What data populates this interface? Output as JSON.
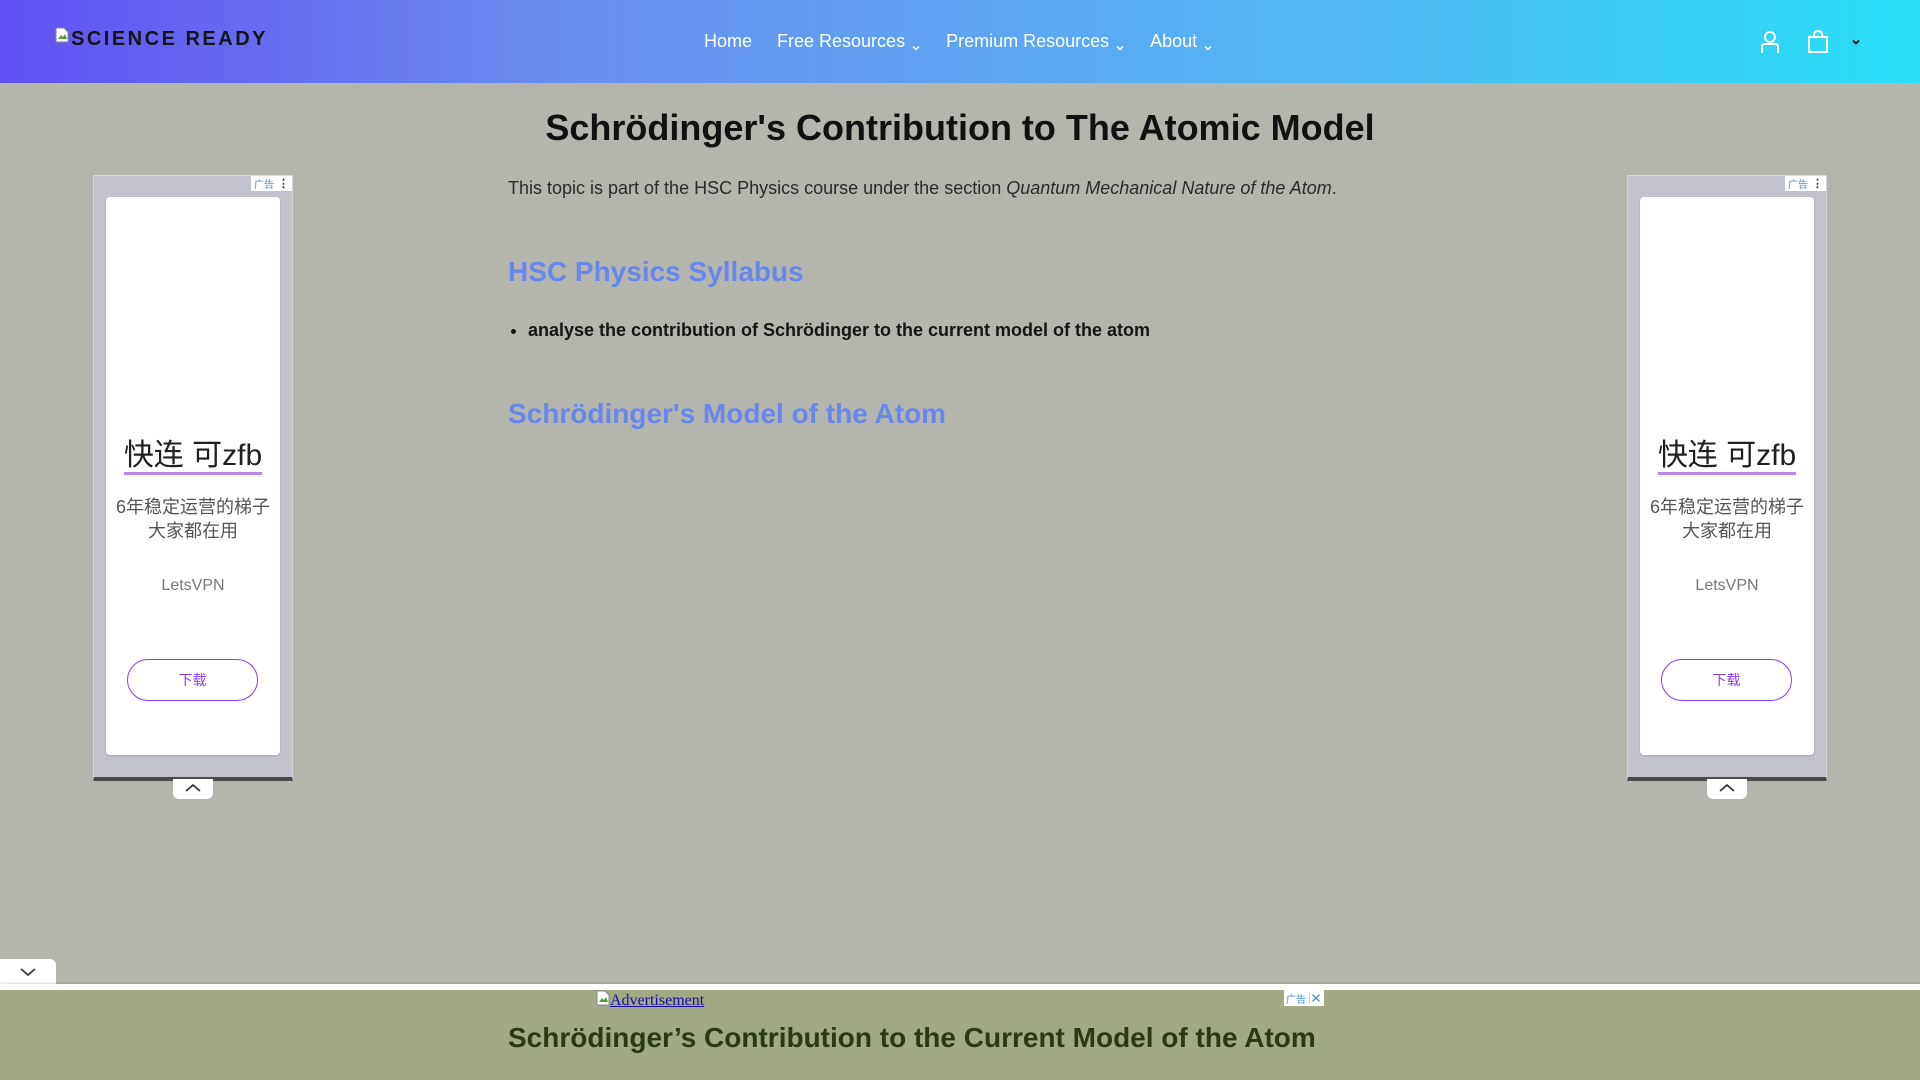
{
  "header": {
    "logo_text": "SCIENCE READY",
    "nav": [
      {
        "label": "Home"
      },
      {
        "label": "Free Resources"
      },
      {
        "label": "Premium Resources"
      },
      {
        "label": "About"
      }
    ],
    "icons": [
      "account-icon",
      "cart-icon",
      "chevron-down-icon"
    ],
    "gradient": [
      "#6150f2",
      "#27dff7"
    ]
  },
  "main": {
    "title": "Schrödinger's Contribution to The Atomic Model",
    "intro_prefix": "This topic is part of the HSC Physics course under the section ",
    "intro_section": "Quantum Mechanical Nature of the Atom",
    "intro_suffix": ".",
    "syllabus_heading": "HSC Physics Syllabus",
    "syllabus_items": [
      "analyse the contribution of Schrödinger to the current model of the atom"
    ],
    "model_heading": "Schrödinger's Model of the Atom",
    "heading_color": "#6787ea"
  },
  "side_ads": {
    "tag": "广告",
    "headline": "快连 可zfb",
    "description": "6年稳定运营的梯子 大家都在用",
    "brand": "LetsVPN",
    "button": "下载"
  },
  "bottom": {
    "ad_alt": "Advertisement",
    "ad_tag": "广告",
    "heading": "Schrödinger’s Contribution to the Current Model of the Atom"
  }
}
